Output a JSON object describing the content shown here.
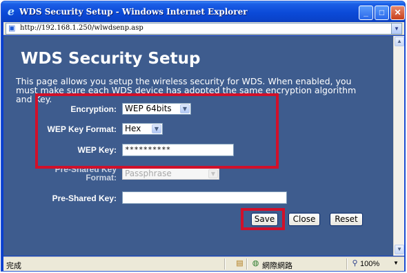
{
  "window": {
    "title": "WDS Security Setup - Windows Internet Explorer",
    "address": "http://192.168.1.250/wlwdsenp.asp",
    "minimize_glyph": "_",
    "maximize_glyph": "□",
    "close_glyph": "✕"
  },
  "page": {
    "title": "WDS Security Setup",
    "description": "This page allows you setup the wireless security for WDS. When enabled, you must make sure each WDS device has adopted the same encryption algorithm and Key."
  },
  "form": {
    "encryption": {
      "label": "Encryption:",
      "value": "WEP 64bits"
    },
    "wep_key_format": {
      "label": "WEP Key Format:",
      "value": "Hex"
    },
    "wep_key": {
      "label": "WEP Key:",
      "value": "**********"
    },
    "psk_format": {
      "label_line1": "Pre-Shared Key",
      "label_line2": "Format:",
      "value": "Passphrase",
      "disabled": true
    },
    "psk": {
      "label": "Pre-Shared Key:",
      "value": ""
    }
  },
  "buttons": {
    "save": "Save",
    "close": "Close",
    "reset": "Reset"
  },
  "statusbar": {
    "status": "完成",
    "zone": "網際網路",
    "zoom": "100%"
  },
  "colors": {
    "page_background": "#3e5c8e",
    "titlebar": "#0b4ad8",
    "highlight": "#d1102a"
  },
  "icons": {
    "browser": "ie-logo-icon",
    "page": "page-icon",
    "zone": "globe-icon",
    "zoom": "magnifier-icon"
  }
}
